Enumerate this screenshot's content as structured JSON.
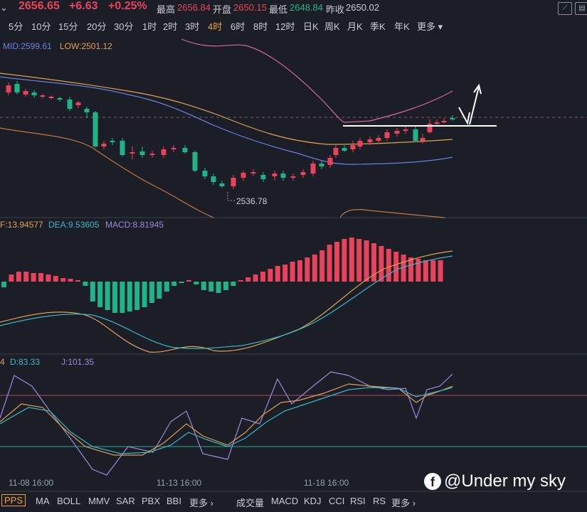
{
  "quote": {
    "price": "2656.65",
    "change": "+6.63",
    "change_pct": "+0.25%",
    "high_label": "最高",
    "high": "2656.84",
    "open_label": "开盘",
    "open": "2650.15",
    "low_label": "最低",
    "low": "2648.84",
    "prev_label": "昨收",
    "prev": "2650.02"
  },
  "periods": [
    "5分",
    "10分",
    "15分",
    "20分",
    "30分",
    "1时",
    "2时",
    "3时",
    "4时",
    "6时",
    "8时",
    "12时",
    "日K",
    "周K",
    "月K",
    "季K",
    "年K",
    "更多"
  ],
  "active_period": "4时",
  "boll": {
    "mid": "MID:2599.61",
    "low": "LOW:2501.12"
  },
  "min_marker": "2536.78",
  "macd": {
    "dif": "F:13.94577",
    "dea": "DEA:9.53605",
    "macd": "MACD:8.81945"
  },
  "kdj": {
    "k": "4",
    "d": "D:83.33",
    "j": "J:101.35"
  },
  "dates": [
    "11-08 16:00",
    "11-13 16:00",
    "11-18 16:00"
  ],
  "indicators_main": [
    "PPS",
    "MA",
    "BOLL",
    "MMV",
    "SAR",
    "PBX",
    "BBI",
    "更多"
  ],
  "indicators_sub": [
    "成交量",
    "MACD",
    "KDJ",
    "CCI",
    "RSI",
    "RS",
    "更多"
  ],
  "watermark": "@Under my sky",
  "colors": {
    "up": "#e8435a",
    "down": "#1fb387",
    "accent": "#f0a040",
    "bg": "#1b1e26"
  }
}
